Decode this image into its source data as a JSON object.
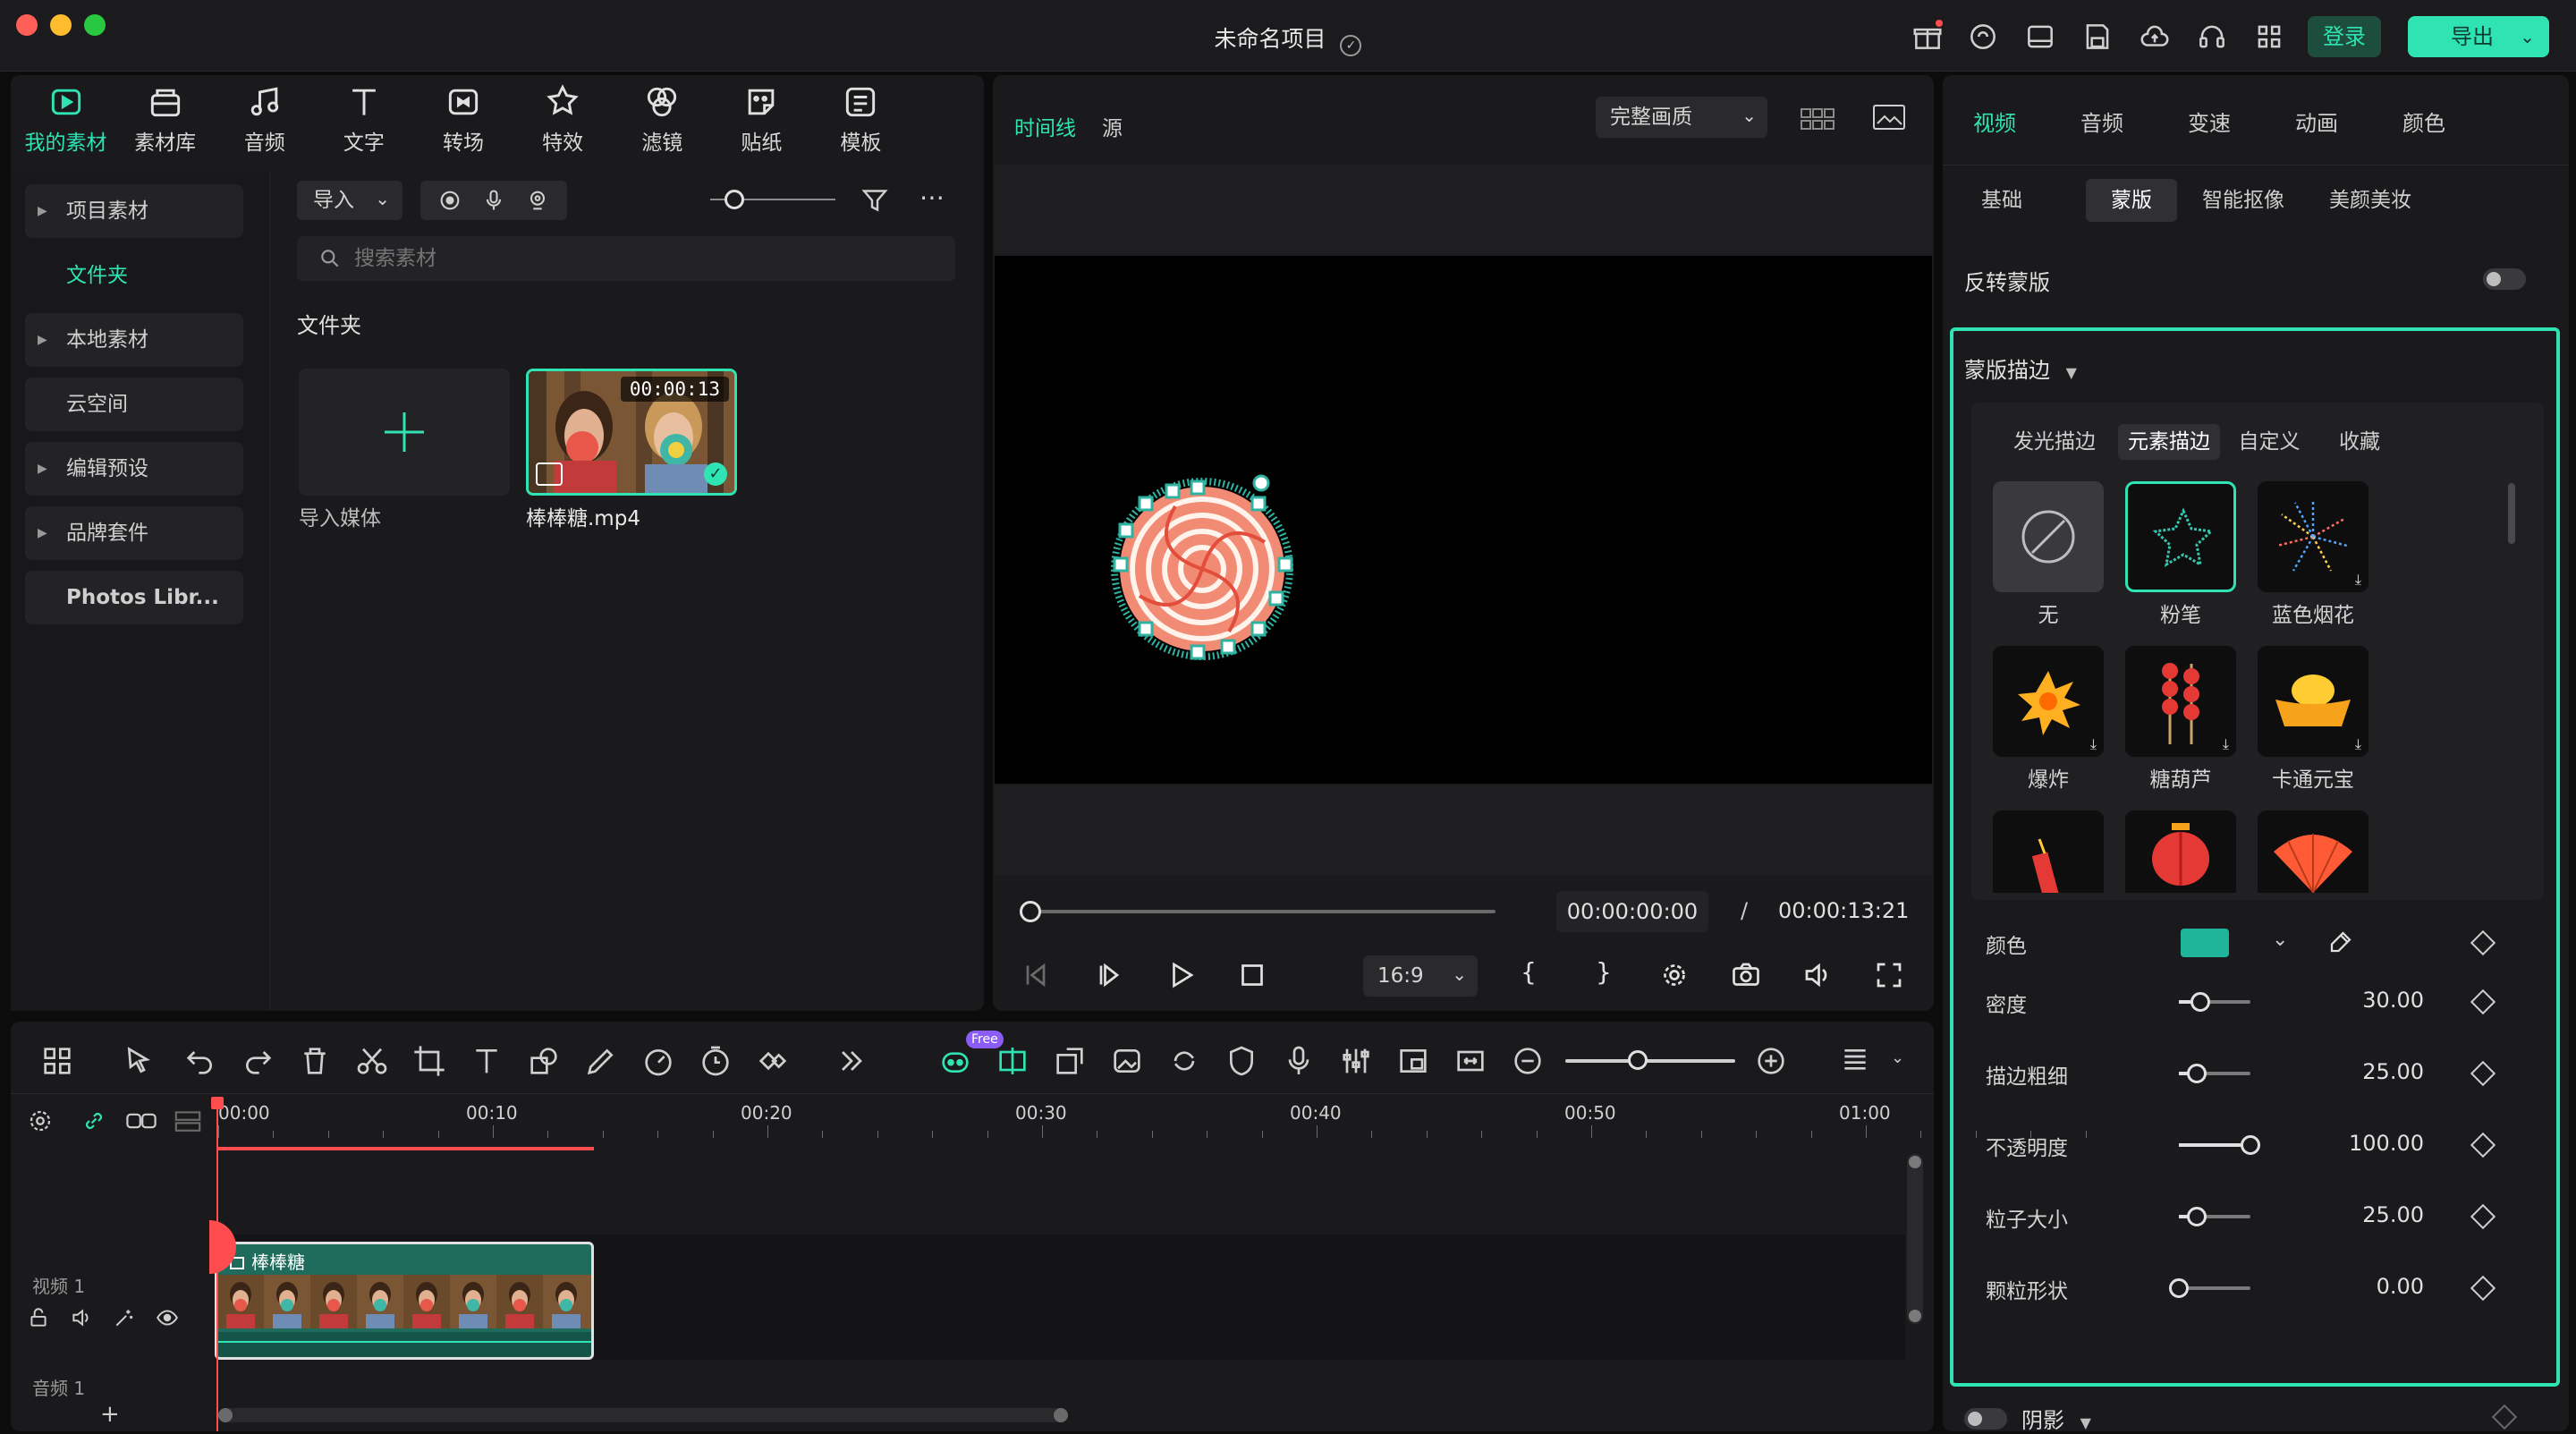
{
  "window": {
    "title": "未命名项目"
  },
  "header": {
    "login": "登录",
    "export": "导出"
  },
  "toolbar": {
    "items": [
      {
        "label": "我的素材",
        "icon": "media-icon",
        "active": true
      },
      {
        "label": "素材库",
        "icon": "stock-icon"
      },
      {
        "label": "音频",
        "icon": "music-icon"
      },
      {
        "label": "文字",
        "icon": "text-icon"
      },
      {
        "label": "转场",
        "icon": "transition-icon"
      },
      {
        "label": "特效",
        "icon": "effects-icon"
      },
      {
        "label": "滤镜",
        "icon": "filter-icon"
      },
      {
        "label": "贴纸",
        "icon": "sticker-icon"
      },
      {
        "label": "模板",
        "icon": "template-icon"
      }
    ]
  },
  "sidebar": {
    "items": [
      {
        "label": "项目素材",
        "caret": true
      },
      {
        "label": "文件夹",
        "active": true
      },
      {
        "label": "本地素材",
        "caret": true
      },
      {
        "label": "云空间"
      },
      {
        "label": "编辑预设",
        "caret": true
      },
      {
        "label": "品牌套件",
        "caret": true
      },
      {
        "label": "Photos Libr..."
      }
    ]
  },
  "media": {
    "import_label": "导入",
    "search_placeholder": "搜索素材",
    "folder_label": "文件夹",
    "import_media_label": "导入媒体",
    "clip": {
      "name": "棒棒糖.mp4",
      "duration": "00:00:13"
    }
  },
  "preview": {
    "tabs": [
      "时间线",
      "源"
    ],
    "quality": "完整画质",
    "current_time": "00:00:00:00",
    "separator": "/",
    "total_time": "00:00:13:21",
    "ratio": "16:9",
    "bracket_in": "{",
    "bracket_out": "}"
  },
  "right": {
    "tabs": [
      "视频",
      "音频",
      "变速",
      "动画",
      "颜色"
    ],
    "subtabs": [
      "基础",
      "蒙版",
      "智能抠像",
      "美颜美妆"
    ],
    "reverse_mask": "反转蒙版",
    "mask_stroke": "蒙版描边",
    "stroke_tabs": [
      "发光描边",
      "元素描边",
      "自定义",
      "收藏"
    ],
    "tiles": [
      {
        "label": "无"
      },
      {
        "label": "粉笔"
      },
      {
        "label": "蓝色烟花"
      },
      {
        "label": "爆炸"
      },
      {
        "label": "糖葫芦"
      },
      {
        "label": "卡通元宝"
      }
    ],
    "color_label": "颜色",
    "color_value": "#1fb59a",
    "params": [
      {
        "label": "密度",
        "value": "30.00",
        "level": 0.3
      },
      {
        "label": "描边粗细",
        "value": "25.00",
        "level": 0.25
      },
      {
        "label": "不透明度",
        "value": "100.00",
        "level": 1.0
      },
      {
        "label": "粒子大小",
        "value": "25.00",
        "level": 0.25
      },
      {
        "label": "颗粒形状",
        "value": "0.00",
        "level": 0.0
      }
    ],
    "shadow": "阴影"
  },
  "timeline": {
    "ticks": [
      "00:00",
      "00:10",
      "00:20",
      "00:30",
      "00:40",
      "00:50",
      "01:00"
    ],
    "free_badge": "Free",
    "track_video": "视频 1",
    "track_audio": "音频 1",
    "clip_title": "棒棒糖"
  },
  "colors": {
    "accent": "#2fe3b3",
    "playhead": "#ff4d4f"
  }
}
